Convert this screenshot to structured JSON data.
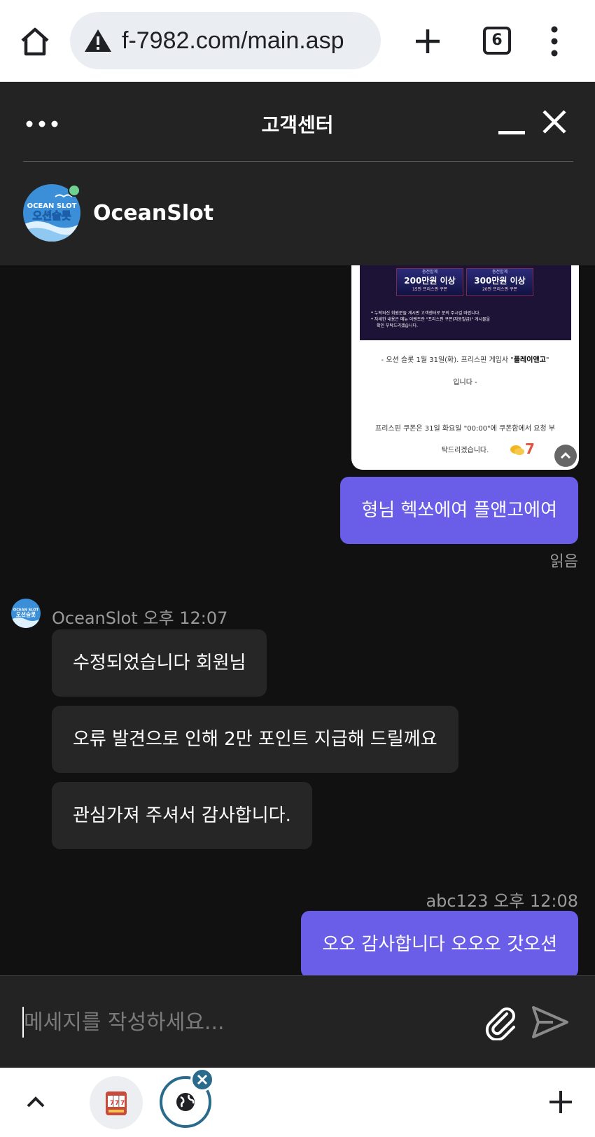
{
  "browser": {
    "url": "f-7982.com/main.asp",
    "tab_count": "6",
    "icons": [
      "home-icon",
      "warning-icon",
      "plus-icon",
      "tabs-icon",
      "more-vertical-icon"
    ]
  },
  "chat_header": {
    "title": "고객센터",
    "agent_name": "OceanSlot",
    "logo_line1": "OCEAN SLOT",
    "logo_line2": "오션슬롯",
    "online_color": "#6fd18f"
  },
  "image_card": {
    "promo1_line1": "충전합계",
    "promo1_amount": "200만원 이상",
    "promo1_line3": "15만 프리스핀 쿠폰",
    "promo2_line1": "충전합계",
    "promo2_amount": "300만원 이상",
    "promo2_line3": "20만 프리스핀 쿠폰",
    "note1": "* 누락되신 회원분들 게시판 고객센터로 문의 주시길 바랍니다.",
    "note2": "* 자세한 내용은 메뉴 이벤트란 \"프리스핀 쿠폰(자동발급)\" 게시물을",
    "note3": "확인 부탁드리겠습니다.",
    "text1_prefix": "- 오션 슬롯 1월 31일(화). 프리스핀 게임사 \"",
    "text1_bold": "플레이앤고",
    "text1_suffix": "\"",
    "text2": "입니다 -",
    "text3": "프리스핀 쿠폰은 31일 화요일 \"00:00\"에 쿠폰함에서 요청 부",
    "text4": "탁드리겠습니다.",
    "comment_count": "7"
  },
  "messages": {
    "user_msg1": "형님 헥쏘에여 플앤고에여",
    "read_label": "읽음",
    "agent_sender": "OceanSlot",
    "agent_time": "오후 12:07",
    "agent_msg1": "수정되었습니다 회원님",
    "agent_msg2": "오류 발견으로 인해 2만 포인트 지급해 드릴께요",
    "agent_msg3": "관심가져 주셔서 감사합니다.",
    "user_sender": "abc123",
    "user_time": "오후 12:08",
    "user_msg2": "오오 감사합니다 오오오 갓오션"
  },
  "composer": {
    "placeholder": "메세지를 작성하세요..."
  },
  "colors": {
    "user_bubble": "#6a5de8",
    "agent_bubble": "#262626",
    "chat_background": "#111111",
    "header_background": "#232323"
  }
}
